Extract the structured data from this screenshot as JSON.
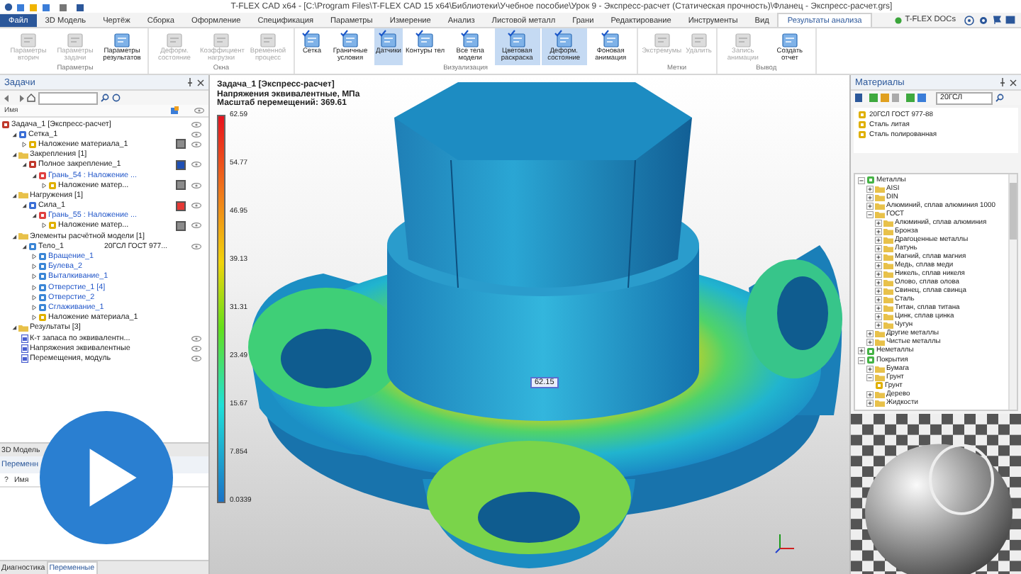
{
  "window": {
    "title": "T-FLEX CAD x64 - [C:\\Program Files\\T-FLEX CAD 15 x64\\Библиотеки\\Учебное пособие\\Урок 9 - Экспресс-расчет (Статическая прочность)\\Фланец - Экспресс-расчет.grs]"
  },
  "menu_tabs": [
    {
      "label": "Файл",
      "kind": "file",
      "selected": false
    },
    {
      "label": "3D Модель",
      "kind": "tab",
      "selected": false
    },
    {
      "label": "Чертёж",
      "kind": "tab",
      "selected": false
    },
    {
      "label": "Сборка",
      "kind": "tab",
      "selected": false
    },
    {
      "label": "Оформление",
      "kind": "tab",
      "selected": false
    },
    {
      "label": "Спецификация",
      "kind": "tab",
      "selected": false
    },
    {
      "label": "Параметры",
      "kind": "tab",
      "selected": false
    },
    {
      "label": "Измерение",
      "kind": "tab",
      "selected": false
    },
    {
      "label": "Анализ",
      "kind": "tab",
      "selected": false
    },
    {
      "label": "Листовой металл",
      "kind": "tab",
      "selected": false
    },
    {
      "label": "Грани",
      "kind": "tab",
      "selected": false
    },
    {
      "label": "Редактирование",
      "kind": "tab",
      "selected": false
    },
    {
      "label": "Инструменты",
      "kind": "tab",
      "selected": false
    },
    {
      "label": "Вид",
      "kind": "tab",
      "selected": false
    },
    {
      "label": "Результаты анализа",
      "kind": "tab",
      "selected": true
    }
  ],
  "account": {
    "label": "T-FLEX DOCs"
  },
  "ribbon": [
    {
      "title": "Параметры",
      "buttons": [
        {
          "label": "Параметры вторич",
          "disabled": true,
          "selected": false
        },
        {
          "label": "Параметры задачи",
          "disabled": true,
          "selected": false
        },
        {
          "label": "Параметры результатов",
          "disabled": false,
          "selected": false
        }
      ]
    },
    {
      "title": "Окна",
      "buttons": [
        {
          "label": "Деформ. состояние",
          "disabled": true,
          "selected": false
        },
        {
          "label": "Коэффициент нагрузки",
          "disabled": true,
          "selected": false
        },
        {
          "label": "Временной процесс",
          "disabled": true,
          "selected": false
        }
      ]
    },
    {
      "title": "Визуализация",
      "buttons": [
        {
          "label": "Сетка",
          "disabled": false,
          "selected": false,
          "checked": true
        },
        {
          "label": "Граничные условия",
          "disabled": false,
          "selected": false,
          "checked": true
        },
        {
          "label": "Датчики",
          "disabled": false,
          "selected": true,
          "checked": true
        },
        {
          "label": "Контуры тел",
          "disabled": false,
          "selected": false,
          "checked": true
        },
        {
          "label": "Все тела модели",
          "disabled": false,
          "selected": false,
          "checked": true
        },
        {
          "label": "Цветовая раскраска",
          "disabled": false,
          "selected": true,
          "checked": true
        },
        {
          "label": "Деформ. состояние",
          "disabled": false,
          "selected": true,
          "checked": true
        },
        {
          "label": "Фоновая анимация",
          "disabled": false,
          "selected": false,
          "checked": true
        }
      ]
    },
    {
      "title": "Метки",
      "buttons": [
        {
          "label": "Экстремумы",
          "disabled": true,
          "selected": false
        },
        {
          "label": "Удалить",
          "disabled": true,
          "selected": false
        }
      ]
    },
    {
      "title": "Вывод",
      "buttons": [
        {
          "label": "Запись анимации",
          "disabled": true,
          "selected": false
        },
        {
          "label": "Создать отчет",
          "disabled": false,
          "selected": false
        }
      ]
    }
  ],
  "tasks_panel": {
    "title": "Задачи",
    "column": "Имя",
    "tree": [
      {
        "label": "Задача_1 [Экспресс-расчет]",
        "kind": "task",
        "visible": true,
        "children": [
          {
            "label": "Сетка_1",
            "kind": "mesh",
            "expanded": true,
            "visible": true,
            "children": [
              {
                "label": "Наложение материала_1",
                "kind": "material",
                "expanded": false,
                "color": "#8c8c8c",
                "visible": true
              }
            ]
          },
          {
            "label": "Закрепления [1]",
            "kind": "folder",
            "expanded": true,
            "children": [
              {
                "label": "Полное закрепление_1",
                "kind": "fix",
                "expanded": true,
                "color": "#1f4fb4",
                "visible": true,
                "children": [
                  {
                    "label": "Грань_54 : Наложение ...",
                    "kind": "face",
                    "expanded": true,
                    "children": [
                      {
                        "label": "Наложение матер...",
                        "kind": "material",
                        "expanded": false,
                        "color": "#8c8c8c",
                        "visible": true
                      }
                    ]
                  }
                ]
              }
            ]
          },
          {
            "label": "Нагружения [1]",
            "kind": "folder",
            "expanded": true,
            "children": [
              {
                "label": "Сила_1",
                "kind": "load",
                "expanded": true,
                "color": "#e53935",
                "visible": true,
                "children": [
                  {
                    "label": "Грань_55 : Наложение ...",
                    "kind": "face",
                    "expanded": true,
                    "children": [
                      {
                        "label": "Наложение матер...",
                        "kind": "material",
                        "expanded": false,
                        "color": "#8c8c8c",
                        "visible": true
                      }
                    ]
                  }
                ]
              }
            ]
          },
          {
            "label": "Элементы расчётной модели [1]",
            "kind": "folder",
            "expanded": true,
            "children": [
              {
                "label": "Тело_1",
                "kind": "body",
                "expanded": true,
                "value": "20ГСЛ ГОСТ 977...",
                "visible": true,
                "children": [
                  {
                    "label": "Вращение_1",
                    "kind": "feature",
                    "expanded": false
                  },
                  {
                    "label": "Булева_2",
                    "kind": "feature",
                    "expanded": false
                  },
                  {
                    "label": "Выталкивание_1",
                    "kind": "feature",
                    "expanded": false
                  },
                  {
                    "label": "Отверстие_1 [4]",
                    "kind": "feature",
                    "expanded": false
                  },
                  {
                    "label": "Отверстие_2",
                    "kind": "feature",
                    "expanded": false
                  },
                  {
                    "label": "Сглаживание_1",
                    "kind": "feature",
                    "expanded": false
                  },
                  {
                    "label": "Наложение материала_1",
                    "kind": "material",
                    "expanded": false
                  }
                ]
              }
            ]
          },
          {
            "label": "Результаты [3]",
            "kind": "folder",
            "expanded": true,
            "children": [
              {
                "label": "К-т запаса по эквивалентн...",
                "kind": "result",
                "visible": true
              },
              {
                "label": "Напряжения эквивалентные",
                "kind": "result",
                "visible": true
              },
              {
                "label": "Перемещения, модуль",
                "kind": "result",
                "visible": true
              }
            ]
          }
        ]
      }
    ]
  },
  "model_tabs": [
    {
      "label": "3D Модель",
      "selected": false
    }
  ],
  "variables_panel": {
    "title": "Переменн",
    "columns": [
      "?",
      "Имя"
    ]
  },
  "bottom_tabs": [
    {
      "label": "Диагностика",
      "selected": false
    },
    {
      "label": "Переменные",
      "selected": true
    }
  ],
  "viewport": {
    "title_lines": [
      "Задача_1 [Экспресс-расчет]",
      "Напряжения эквивалентные, МПа",
      "Масштаб перемещений: 369.61"
    ],
    "legend": [
      "62.59",
      "54.77",
      "46.95",
      "39.13",
      "31.31",
      "23.49",
      "15.67",
      "7.854",
      "0.0339"
    ],
    "probe_label": "62.15"
  },
  "materials_panel": {
    "title": "Материалы",
    "filter": "20ГСЛ",
    "list": [
      "20ГСЛ ГОСТ 977-88",
      "Сталь литая",
      "Сталь полированная"
    ],
    "tree": [
      {
        "label": "Металлы",
        "kind": "library",
        "expanded": true,
        "children": [
          {
            "label": "AISI",
            "kind": "folder",
            "expanded": false
          },
          {
            "label": "DIN",
            "kind": "folder",
            "expanded": false
          },
          {
            "label": "Алюминий, сплав алюминия 1000",
            "kind": "folder",
            "expanded": false
          },
          {
            "label": "ГОСТ",
            "kind": "folder",
            "expanded": true,
            "children": [
              {
                "label": "Алюминий, сплав алюминия",
                "kind": "folder",
                "expanded": false
              },
              {
                "label": "Бронза",
                "kind": "folder",
                "expanded": false
              },
              {
                "label": "Драгоценные металлы",
                "kind": "folder",
                "expanded": false
              },
              {
                "label": "Латунь",
                "kind": "folder",
                "expanded": false
              },
              {
                "label": "Магний, сплав магния",
                "kind": "folder",
                "expanded": false
              },
              {
                "label": "Медь, сплав меди",
                "kind": "folder",
                "expanded": false
              },
              {
                "label": "Никель, сплав никеля",
                "kind": "folder",
                "expanded": false
              },
              {
                "label": "Олово, сплав олова",
                "kind": "folder",
                "expanded": false
              },
              {
                "label": "Свинец, сплав свинца",
                "kind": "folder",
                "expanded": false
              },
              {
                "label": "Сталь",
                "kind": "folder",
                "expanded": false
              },
              {
                "label": "Титан, сплав титана",
                "kind": "folder",
                "expanded": false
              },
              {
                "label": "Цинк, сплав цинка",
                "kind": "folder",
                "expanded": false
              },
              {
                "label": "Чугун",
                "kind": "folder",
                "expanded": false
              }
            ]
          },
          {
            "label": "Другие металлы",
            "kind": "folder",
            "expanded": false
          },
          {
            "label": "Чистые металлы",
            "kind": "folder",
            "expanded": false
          }
        ]
      },
      {
        "label": "Неметаллы",
        "kind": "library",
        "expanded": false
      },
      {
        "label": "Покрытия",
        "kind": "library",
        "expanded": true,
        "children": [
          {
            "label": "Бумага",
            "kind": "folder",
            "expanded": false
          },
          {
            "label": "Грунт",
            "kind": "folder",
            "expanded": true,
            "children": [
              {
                "label": "Грунт",
                "kind": "material"
              }
            ]
          },
          {
            "label": "Дерево",
            "kind": "folder",
            "expanded": false
          },
          {
            "label": "Жидкости",
            "kind": "folder",
            "expanded": false
          }
        ]
      }
    ]
  }
}
